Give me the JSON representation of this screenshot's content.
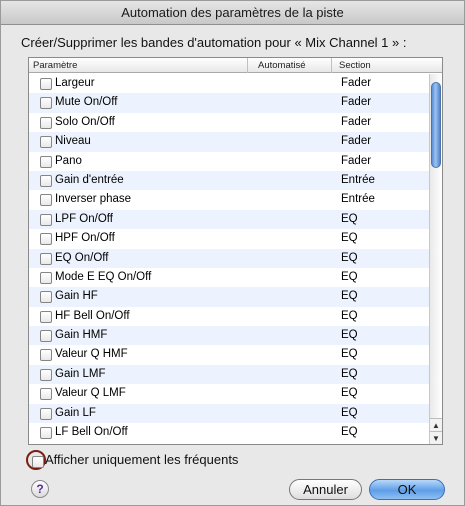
{
  "window": {
    "title": "Automation des paramètres de la piste"
  },
  "prompt": "Créer/Supprimer les bandes d'automation pour « Mix Channel 1 » :",
  "table": {
    "columns": [
      "Paramètre",
      "Automatisé",
      "Section"
    ],
    "rows": [
      {
        "name": "Largeur",
        "automated": "",
        "section": "Fader"
      },
      {
        "name": "Mute On/Off",
        "automated": "",
        "section": "Fader"
      },
      {
        "name": "Solo On/Off",
        "automated": "",
        "section": "Fader"
      },
      {
        "name": "Niveau",
        "automated": "",
        "section": "Fader"
      },
      {
        "name": "Pano",
        "automated": "",
        "section": "Fader"
      },
      {
        "name": "Gain d'entrée",
        "automated": "",
        "section": "Entrée"
      },
      {
        "name": "Inverser phase",
        "automated": "",
        "section": "Entrée"
      },
      {
        "name": "LPF On/Off",
        "automated": "",
        "section": "EQ"
      },
      {
        "name": "HPF On/Off",
        "automated": "",
        "section": "EQ"
      },
      {
        "name": "EQ On/Off",
        "automated": "",
        "section": "EQ"
      },
      {
        "name": "Mode E EQ On/Off",
        "automated": "",
        "section": "EQ"
      },
      {
        "name": "Gain HF",
        "automated": "",
        "section": "EQ"
      },
      {
        "name": "HF Bell On/Off",
        "automated": "",
        "section": "EQ"
      },
      {
        "name": "Gain HMF",
        "automated": "",
        "section": "EQ"
      },
      {
        "name": "Valeur Q HMF",
        "automated": "",
        "section": "EQ"
      },
      {
        "name": "Gain LMF",
        "automated": "",
        "section": "EQ"
      },
      {
        "name": "Valeur Q LMF",
        "automated": "",
        "section": "EQ"
      },
      {
        "name": "Gain LF",
        "automated": "",
        "section": "EQ"
      },
      {
        "name": "LF Bell On/Off",
        "automated": "",
        "section": "EQ"
      }
    ]
  },
  "scrollbar": {
    "up_glyph": "▲",
    "down_glyph": "▼"
  },
  "frequent_only": {
    "label": "Afficher uniquement les fréquents",
    "checked": false
  },
  "help": {
    "glyph": "?"
  },
  "buttons": {
    "cancel": "Annuler",
    "ok": "OK"
  },
  "colors": {
    "accent": "#5e9ee8",
    "row_alt": "#edf3fe",
    "highlight_ring": "#7a1e12"
  }
}
